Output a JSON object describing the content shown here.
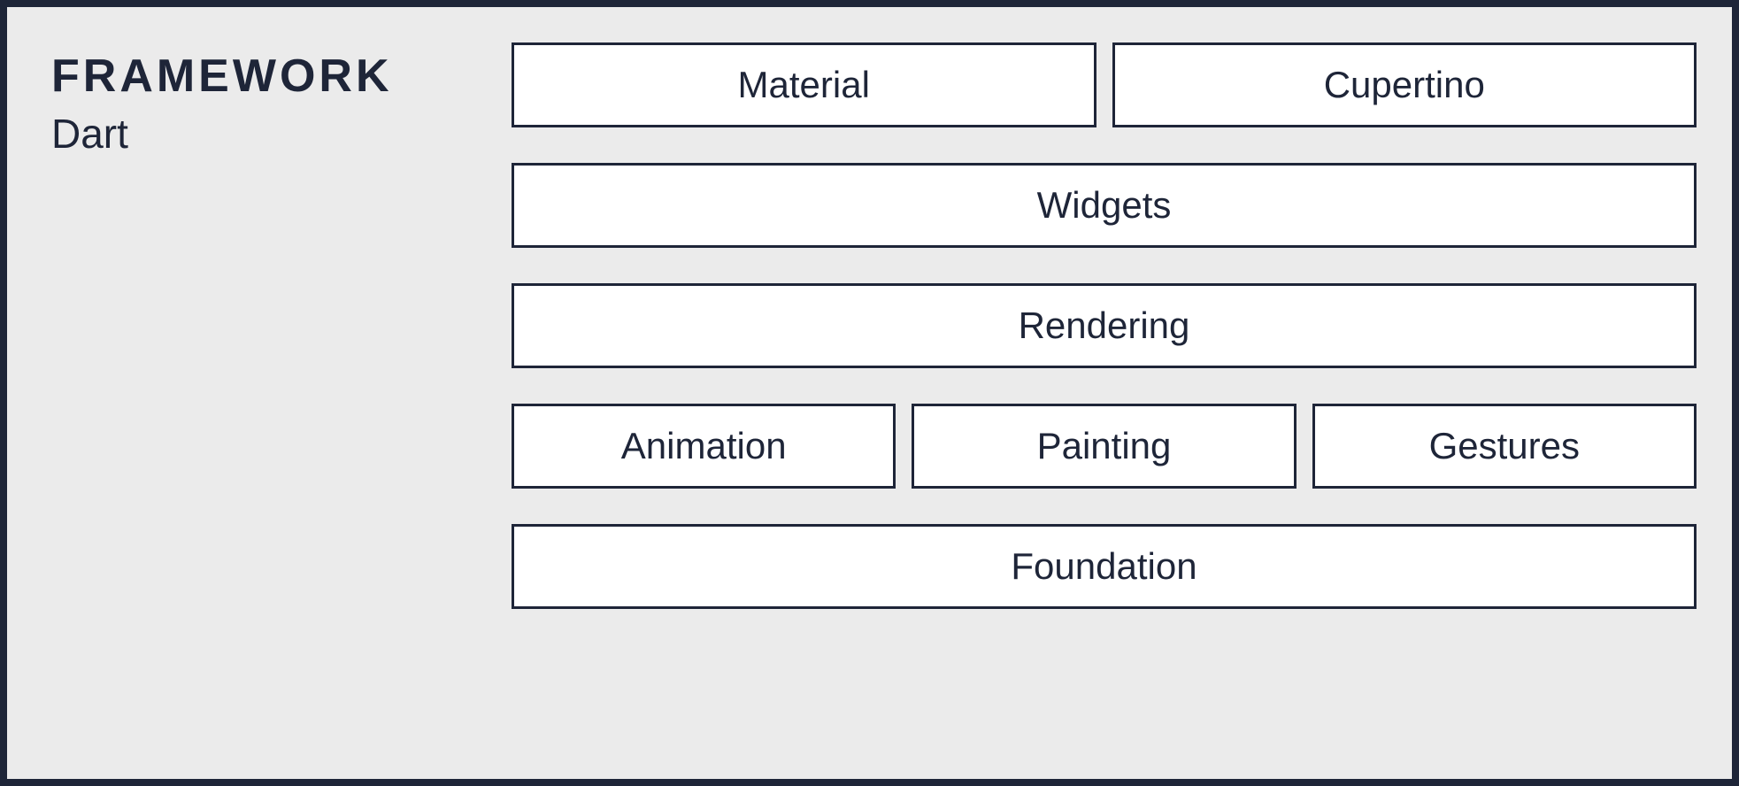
{
  "header": {
    "title": "FRAMEWORK",
    "subtitle": "Dart"
  },
  "layers": {
    "row1": {
      "material": "Material",
      "cupertino": "Cupertino"
    },
    "row2": {
      "widgets": "Widgets"
    },
    "row3": {
      "rendering": "Rendering"
    },
    "row4": {
      "animation": "Animation",
      "painting": "Painting",
      "gestures": "Gestures"
    },
    "row5": {
      "foundation": "Foundation"
    }
  }
}
